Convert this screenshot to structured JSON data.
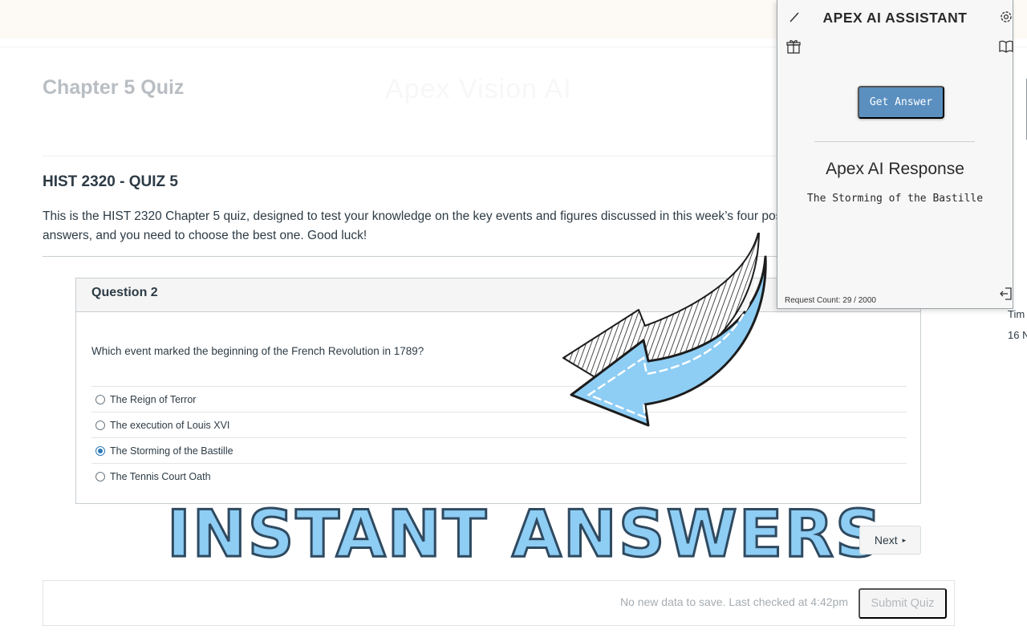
{
  "page": {
    "title": "Chapter 5 Quiz",
    "watermark": "Apex Vision AI"
  },
  "quiz": {
    "heading": "HIST 2320 - QUIZ 5",
    "description": "This is the HIST 2320 Chapter 5 quiz, designed to test your knowledge on the key events and figures discussed in this week’s four possible answers, and you need to choose the best one. Good luck!"
  },
  "question": {
    "header": "Question 2",
    "text": "Which event marked the beginning of the French Revolution in 1789?",
    "answers": [
      {
        "label": "The Reign of Terror",
        "selected": false
      },
      {
        "label": "The execution of Louis XVI",
        "selected": false
      },
      {
        "label": "The Storming of the Bastille",
        "selected": true
      },
      {
        "label": "The Tennis Court Oath",
        "selected": false
      }
    ]
  },
  "promo": {
    "text": "INSTANT ANSWERS",
    "fill_color": "#8ecdf4",
    "stroke_color": "#2f4a60"
  },
  "navigation": {
    "next_label": "Next",
    "next_icon": "triangle-right-icon"
  },
  "footer": {
    "save_status": "No new data to save. Last checked at 4:42pm",
    "submit_label": "Submit Quiz"
  },
  "sidebar_partial": {
    "line1": "Tim",
    "line2": "16 N"
  },
  "ai_panel": {
    "title": "APEX AI ASSISTANT",
    "get_answer_label": "Get Answer",
    "response_title": "Apex AI Response",
    "response_text": "The Storming of the Bastille",
    "request_count": "Request Count: 29 / 2000",
    "icons": [
      "pencil-icon",
      "gear-icon",
      "gift-icon",
      "book-icon",
      "logout-icon"
    ],
    "button_color": "#5a8fc0"
  }
}
